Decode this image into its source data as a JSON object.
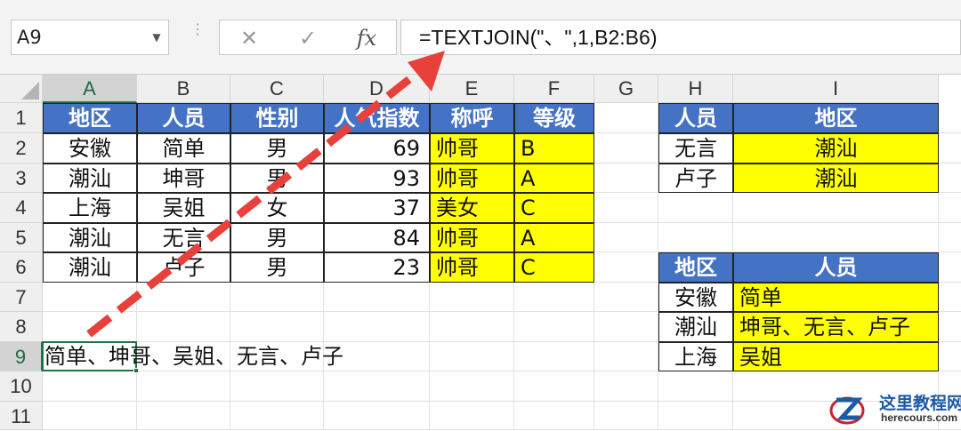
{
  "formula_bar": {
    "name_box": "A9",
    "cancel_icon": "✕",
    "enter_icon": "✓",
    "fx_label": "fx",
    "formula": "=TEXTJOIN(\"、\",1,B2:B6)"
  },
  "columns": [
    "A",
    "B",
    "C",
    "D",
    "E",
    "F",
    "G",
    "H",
    "I"
  ],
  "rows": [
    "1",
    "2",
    "3",
    "4",
    "5",
    "6",
    "7",
    "8",
    "9",
    "10",
    "11"
  ],
  "main_table": {
    "headers": [
      "地区",
      "人员",
      "性别",
      "人气指数",
      "称呼",
      "等级"
    ],
    "rows": [
      [
        "安徽",
        "简单",
        "男",
        "69",
        "帅哥",
        "B"
      ],
      [
        "潮汕",
        "坤哥",
        "男",
        "93",
        "帅哥",
        "A"
      ],
      [
        "上海",
        "吴姐",
        "女",
        "37",
        "美女",
        "C"
      ],
      [
        "潮汕",
        "无言",
        "男",
        "84",
        "帅哥",
        "A"
      ],
      [
        "潮汕",
        "卢子",
        "男",
        "23",
        "帅哥",
        "C"
      ]
    ]
  },
  "lookup_table": {
    "headers": [
      "人员",
      "地区"
    ],
    "rows": [
      [
        "无言",
        "潮汕"
      ],
      [
        "卢子",
        "潮汕"
      ]
    ]
  },
  "summary_table": {
    "headers": [
      "地区",
      "人员"
    ],
    "rows": [
      [
        "安徽",
        "简单"
      ],
      [
        "潮汕",
        "坤哥、无言、卢子"
      ],
      [
        "上海",
        "吴姐"
      ]
    ]
  },
  "result_cell": "简单、坤哥、吴姐、无言、卢子",
  "annotation_color": "#e8403a",
  "watermark": {
    "title": "这里教程网",
    "url": "herecours.com"
  }
}
